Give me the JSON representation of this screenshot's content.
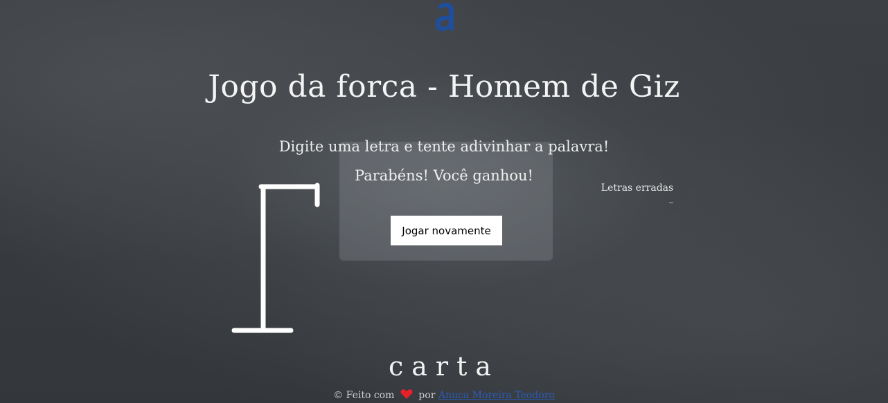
{
  "header": {
    "logo_letter": "a",
    "logo_color": "#1f4e9c"
  },
  "game": {
    "title": "Jogo da forca - Homem de Giz",
    "instruction": "Digite uma letra e tente adivinhar a palavra!",
    "wrong_letters_label": "Letras erradas",
    "wrong_letters": ""
  },
  "popup": {
    "message": "Parabéns! Você ganhou!",
    "play_again_label": "Jogar novamente"
  },
  "footer": {
    "brand": "carta",
    "made_with_prefix": "© Feito com",
    "heart_icon": "heart-icon",
    "heart_color": "#e8202a",
    "by_label": "por",
    "author_link_text": "Anuca Moreira Teodoro"
  }
}
